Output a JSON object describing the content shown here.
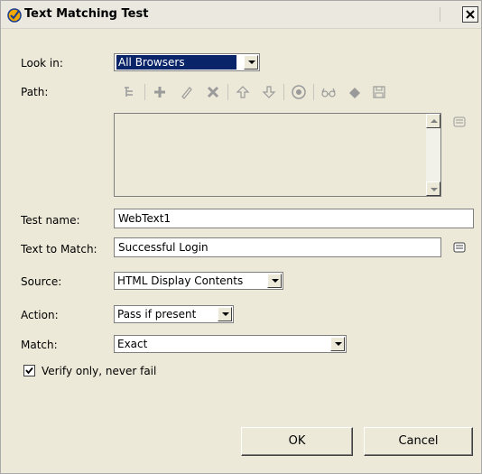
{
  "window": {
    "title": "Text Matching Test"
  },
  "look_in": {
    "label": "Look in:",
    "value": "All Browsers"
  },
  "path": {
    "label": "Path:"
  },
  "toolbar": {
    "icons": [
      "tree-icon",
      "add-icon",
      "edit-icon",
      "delete-icon",
      "move-up-icon",
      "move-down-icon",
      "target-icon",
      "glasses-icon",
      "eraser-icon",
      "save-icon"
    ]
  },
  "test_name": {
    "label": "Test name:",
    "value": "WebText1"
  },
  "text_to_match": {
    "label": "Text to Match:",
    "value": "Successful Login"
  },
  "source": {
    "label": "Source:",
    "value": "HTML Display Contents"
  },
  "action": {
    "label": "Action:",
    "value": "Pass if present"
  },
  "match": {
    "label": "Match:",
    "value": "Exact"
  },
  "verify": {
    "label": "Verify only, never fail",
    "checked": true
  },
  "buttons": {
    "ok": "OK",
    "cancel": "Cancel"
  }
}
